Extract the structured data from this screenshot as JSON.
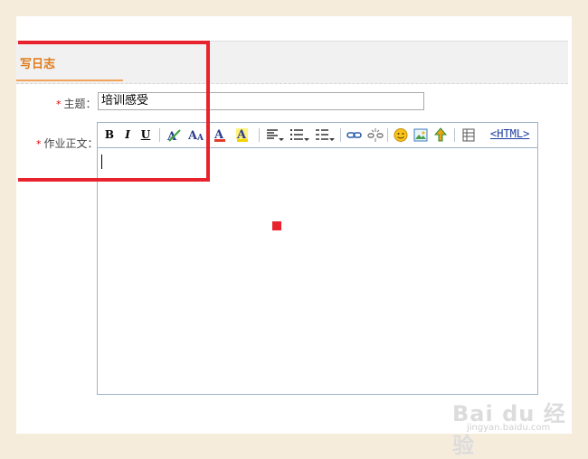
{
  "header": {
    "title": "写日志"
  },
  "form": {
    "subject_label": "主题：",
    "subject_value": "培训感受",
    "body_label": "作业正文：",
    "required_mark": "*"
  },
  "toolbar": {
    "bold": "B",
    "italic": "I",
    "underline": "U",
    "html_label": "<HTML>",
    "icons": [
      "bold-icon",
      "italic-icon",
      "underline-icon",
      "clear-format-icon",
      "font-size-icon",
      "font-color-icon",
      "highlight-color-icon",
      "align-icon",
      "unordered-list-icon",
      "ordered-list-icon",
      "link-icon",
      "unlink-icon",
      "emoticon-icon",
      "image-icon",
      "upload-icon",
      "table-icon"
    ]
  },
  "colors": {
    "accent": "#e07b1a",
    "highlight": "#e8232e",
    "link": "#1a3d9e"
  },
  "watermark": {
    "text": "Bai du 经验",
    "sub": "jingyan.baidu.com"
  }
}
